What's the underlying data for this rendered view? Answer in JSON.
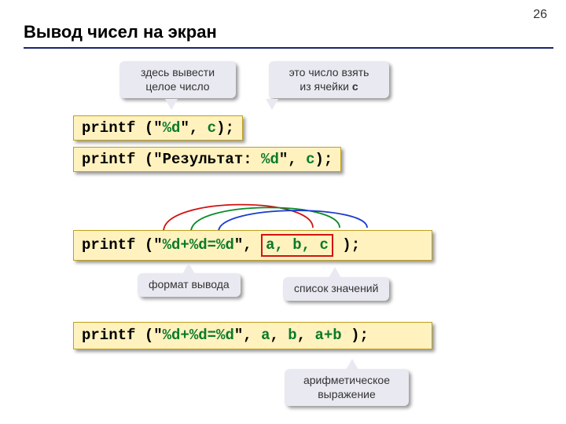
{
  "page_number": "26",
  "title": "Вывод чисел на экран",
  "callouts": {
    "out_int": "здесь вывести\nцелое число",
    "from_cell_pre": "это число взять\nиз ячейки ",
    "from_cell_bold": "c",
    "format": "формат вывода",
    "values_list": "список значений",
    "arith_expr": "арифметическое\nвыражение"
  },
  "code": {
    "line1_a": "printf (\"",
    "line1_b": "%d",
    "line1_c": "\", ",
    "line1_d": "c",
    "line1_e": ");",
    "line2_a": "printf (\"Результат: ",
    "line2_b": "%d",
    "line2_c": "\", ",
    "line2_d": "c",
    "line2_e": ");",
    "line3_a": "printf (\"",
    "line3_b": "%d+%d=%d",
    "line3_c": "\", ",
    "line3_abc": "a, b, c",
    "line3_tail": " );",
    "line4_a": "printf (\"",
    "line4_b": "%d+%d=%d",
    "line4_c": "\", ",
    "line4_d": "a",
    "line4_e": ", ",
    "line4_f": "b",
    "line4_g": ", ",
    "line4_h": "a+b",
    "line4_tail": " );"
  }
}
